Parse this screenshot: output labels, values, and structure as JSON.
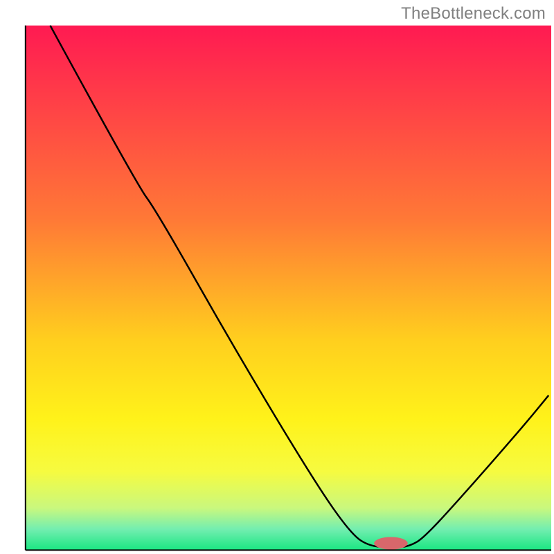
{
  "watermark": "TheBottleneck.com",
  "chart_data": {
    "type": "line",
    "title": "",
    "xlabel": "",
    "ylabel": "",
    "xlim": [
      0,
      100
    ],
    "ylim": [
      0,
      100
    ],
    "gradient_stops": [
      {
        "offset": 0,
        "color": "#ff1a52"
      },
      {
        "offset": 37,
        "color": "#ff7936"
      },
      {
        "offset": 60,
        "color": "#ffcf1e"
      },
      {
        "offset": 75,
        "color": "#fff21a"
      },
      {
        "offset": 85,
        "color": "#f6fb40"
      },
      {
        "offset": 92,
        "color": "#c9f87e"
      },
      {
        "offset": 96,
        "color": "#73eeb0"
      },
      {
        "offset": 100,
        "color": "#19e682"
      }
    ],
    "curve": [
      {
        "x": 4.7,
        "y": 100.0
      },
      {
        "x": 21.0,
        "y": 70.0
      },
      {
        "x": 25.0,
        "y": 64.5
      },
      {
        "x": 40.0,
        "y": 38.0
      },
      {
        "x": 55.0,
        "y": 13.0
      },
      {
        "x": 62.0,
        "y": 3.0
      },
      {
        "x": 65.5,
        "y": 0.7
      },
      {
        "x": 70.0,
        "y": 0.5
      },
      {
        "x": 73.0,
        "y": 0.7
      },
      {
        "x": 76.0,
        "y": 2.5
      },
      {
        "x": 85.0,
        "y": 12.5
      },
      {
        "x": 95.0,
        "y": 24.0
      },
      {
        "x": 99.5,
        "y": 29.5
      }
    ],
    "marker": {
      "x": 69.5,
      "y": 1.3,
      "rx": 3.2,
      "ry": 1.2
    },
    "axis": {
      "left": 4.6,
      "bottom": 99.3,
      "right": 99.5,
      "top": 4.6
    }
  }
}
